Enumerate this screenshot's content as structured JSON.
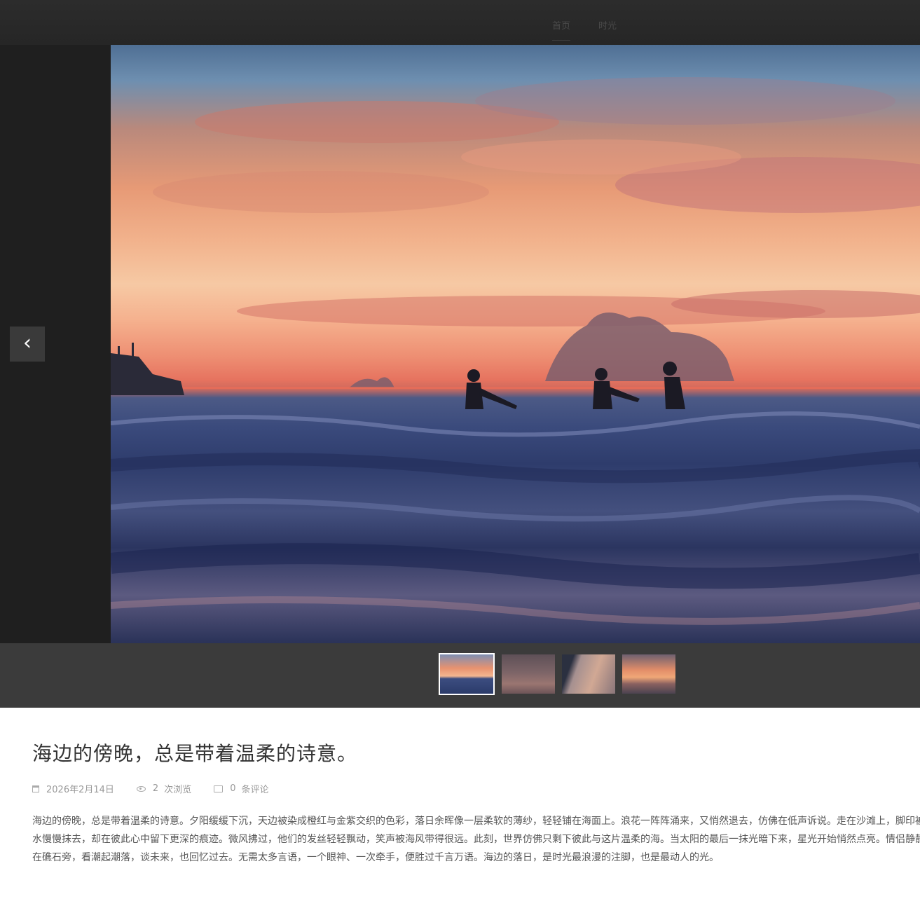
{
  "nav": {
    "items": [
      {
        "label": "首页",
        "active": true
      },
      {
        "label": "时光",
        "active": false
      }
    ]
  },
  "viewer": {
    "prev_label": "‹",
    "photo_icon": "sunset-sea-photo",
    "thumbnails": [
      {
        "name": "sunset-boat-thumbnail",
        "active": true
      },
      {
        "name": "couple-dusk-thumbnail",
        "active": false
      },
      {
        "name": "sailboat-beach-thumbnail",
        "active": false
      },
      {
        "name": "sunset-couple-thumbnail",
        "active": false
      }
    ]
  },
  "article": {
    "title": "海边的傍晚，总是带着温柔的诗意。",
    "date": "2026年2月14日",
    "views_count": "2",
    "views_label": "次浏览",
    "comments_count": "0",
    "comments_label": "条评论",
    "body": "海边的傍晚，总是带着温柔的诗意。夕阳缓缓下沉，天边被染成橙红与金紫交织的色彩，落日余晖像一层柔软的薄纱，轻轻铺在海面上。浪花一阵阵涌来，又悄然退去，仿佛在低声诉说。走在沙滩上，脚印被潮水慢慢抹去，却在彼此心中留下更深的痕迹。微风拂过，他们的发丝轻轻飘动，笑声被海风带得很远。此刻，世界仿佛只剩下彼此与这片温柔的海。当太阳的最后一抹光暗下来，星光开始悄然点亮。情侣静静坐在礁石旁，看潮起潮落，谈未来，也回忆过去。无需太多言语，一个眼神、一次牵手，便胜过千言万语。海边的落日，是时光最浪漫的注脚，也是最动人的光。"
  },
  "colors": {
    "topbar": "#262626",
    "viewer_bg": "#1f1f1f",
    "thumb_strip": "#3b3b3b",
    "text": "#555555",
    "title": "#333333"
  }
}
